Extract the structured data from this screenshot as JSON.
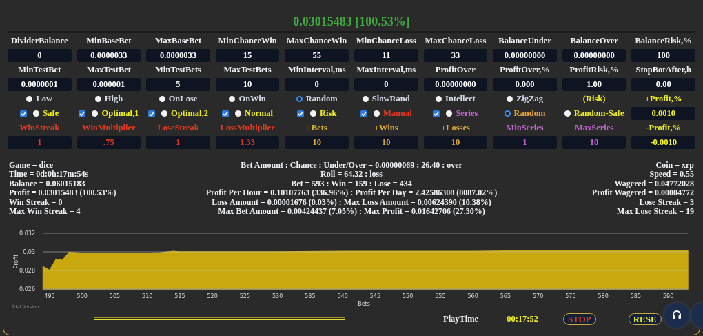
{
  "title": "0.03015483 [100.53%]",
  "settings": {
    "rows": [
      {
        "cells": [
          {
            "kind": "label",
            "text": "DividerBalance"
          },
          {
            "kind": "label",
            "text": "MinBaseBet"
          },
          {
            "kind": "label",
            "text": "MaxBaseBet"
          },
          {
            "kind": "label",
            "text": "MinChanceWin"
          },
          {
            "kind": "label",
            "text": "MaxChanceWin"
          },
          {
            "kind": "label",
            "text": "MinChanceLoss"
          },
          {
            "kind": "label",
            "text": "MaxChanceLoss"
          },
          {
            "kind": "label",
            "text": "BalanceUnder"
          },
          {
            "kind": "label",
            "text": "BalanceOver"
          },
          {
            "kind": "label",
            "text": "BalanceRisk,%"
          }
        ]
      },
      {
        "cells": [
          {
            "kind": "input",
            "value": "0"
          },
          {
            "kind": "input",
            "value": "0.0000033"
          },
          {
            "kind": "input",
            "value": "0.0000033"
          },
          {
            "kind": "input",
            "value": "15"
          },
          {
            "kind": "input",
            "value": "55"
          },
          {
            "kind": "input",
            "value": "11"
          },
          {
            "kind": "input",
            "value": "33"
          },
          {
            "kind": "input",
            "value": "0.00000000"
          },
          {
            "kind": "input",
            "value": "0.00000000"
          },
          {
            "kind": "input",
            "value": "100"
          }
        ]
      },
      {
        "cells": [
          {
            "kind": "label",
            "text": "MinTestBet"
          },
          {
            "kind": "label",
            "text": "MaxTestBet"
          },
          {
            "kind": "label",
            "text": "MinTestBets"
          },
          {
            "kind": "label",
            "text": "MaxTestBets"
          },
          {
            "kind": "label",
            "text": "MinInterval,ms"
          },
          {
            "kind": "label",
            "text": "MaxInterval,ms"
          },
          {
            "kind": "label",
            "text": "ProfitOver"
          },
          {
            "kind": "label",
            "text": "ProfitOver,%"
          },
          {
            "kind": "label",
            "text": "ProfitRisk,%"
          },
          {
            "kind": "label",
            "text": "StopBotAfter,h"
          }
        ]
      },
      {
        "cells": [
          {
            "kind": "input",
            "value": "0.0000001"
          },
          {
            "kind": "input",
            "value": "0.000001"
          },
          {
            "kind": "input",
            "value": "5"
          },
          {
            "kind": "input",
            "value": "10"
          },
          {
            "kind": "input",
            "value": "0"
          },
          {
            "kind": "input",
            "value": "0"
          },
          {
            "kind": "input",
            "value": "0.00000000"
          },
          {
            "kind": "input",
            "value": "0.000"
          },
          {
            "kind": "input",
            "value": "1.00"
          },
          {
            "kind": "input",
            "value": "0.00"
          }
        ]
      },
      {
        "cells": [
          {
            "kind": "radio",
            "label": "Low",
            "selected": false
          },
          {
            "kind": "radio",
            "label": "High",
            "selected": false
          },
          {
            "kind": "radio",
            "label": "OnLose",
            "selected": false
          },
          {
            "kind": "radio",
            "label": "OnWin",
            "selected": false
          },
          {
            "kind": "radio",
            "label": "Random",
            "selected": true
          },
          {
            "kind": "radio",
            "label": "SlowRand",
            "selected": false
          },
          {
            "kind": "radio",
            "label": "Intellect",
            "selected": false
          },
          {
            "kind": "radio",
            "label": "ZigZag",
            "selected": false
          },
          {
            "kind": "label",
            "text": "(Risk)",
            "color": "#f0f020"
          },
          {
            "kind": "label",
            "text": "+Profit,%",
            "color": "#f0f020"
          }
        ]
      },
      {
        "cells": [
          {
            "kind": "check-radio",
            "label": "Safe",
            "checked": true,
            "selected": false,
            "color": "#f0f020"
          },
          {
            "kind": "check-radio",
            "label": "Optimal,1",
            "checked": true,
            "selected": false,
            "color": "#f0f020"
          },
          {
            "kind": "check-radio",
            "label": "Optimal,2",
            "checked": true,
            "selected": false,
            "color": "#f0f020"
          },
          {
            "kind": "check-radio",
            "label": "Normal",
            "checked": true,
            "selected": false,
            "color": "#f0f020"
          },
          {
            "kind": "check-radio",
            "label": "Risk",
            "checked": true,
            "selected": false,
            "color": "#f0f020"
          },
          {
            "kind": "check-radio",
            "label": "Manual",
            "checked": true,
            "selected": false,
            "color": "#e03a22"
          },
          {
            "kind": "check-radio",
            "label": "Series",
            "checked": true,
            "selected": false,
            "color": "#c264d2"
          },
          {
            "kind": "radio",
            "label": "Random",
            "selected": true,
            "color": "#e0a23a"
          },
          {
            "kind": "radio",
            "label": "Random-Safe",
            "selected": false,
            "color": "#f0f020"
          },
          {
            "kind": "input",
            "value": "0.0010",
            "color": "#f0f020"
          }
        ]
      },
      {
        "cells": [
          {
            "kind": "label",
            "text": "WinStreak",
            "color": "#e03a22"
          },
          {
            "kind": "label",
            "text": "WinMultiplier",
            "color": "#e03a22"
          },
          {
            "kind": "label",
            "text": "LoseStreak",
            "color": "#e03a22"
          },
          {
            "kind": "label",
            "text": "LossMultiplier",
            "color": "#e03a22"
          },
          {
            "kind": "label",
            "text": "+Bets",
            "color": "#d8a83a"
          },
          {
            "kind": "label",
            "text": "+Wins",
            "color": "#d8a83a"
          },
          {
            "kind": "label",
            "text": "+Losses",
            "color": "#d8a83a"
          },
          {
            "kind": "label",
            "text": "MinSeries",
            "color": "#c264d2"
          },
          {
            "kind": "label",
            "text": "MaxSeries",
            "color": "#c264d2"
          },
          {
            "kind": "label",
            "text": "-Profit,%",
            "color": "#f0f020"
          }
        ]
      },
      {
        "cells": [
          {
            "kind": "input",
            "value": "1",
            "color": "#e03a22"
          },
          {
            "kind": "input",
            "value": ".75",
            "color": "#e03a22"
          },
          {
            "kind": "input",
            "value": "1",
            "color": "#e03a22"
          },
          {
            "kind": "input",
            "value": "1.33",
            "color": "#e03a22"
          },
          {
            "kind": "input",
            "value": "10",
            "color": "#d8a83a"
          },
          {
            "kind": "input",
            "value": "10",
            "color": "#d8a83a"
          },
          {
            "kind": "input",
            "value": "10",
            "color": "#d8a83a"
          },
          {
            "kind": "input",
            "value": "1",
            "color": "#c264d2"
          },
          {
            "kind": "input",
            "value": "10",
            "color": "#c264d2"
          },
          {
            "kind": "input",
            "value": "-0.0010",
            "color": "#f0f020"
          }
        ]
      }
    ]
  },
  "stats": {
    "left": [
      "Game = dice",
      "Time = 0d:0h:17m:54s",
      "Balance = 0.06015183",
      "Profit = 0.03015483 (100.53%)",
      "Win Streak = 0",
      "Max Win Streak = 4"
    ],
    "center": [
      "Bet Amount : Chance : Under/Over = 0.00000069 : 26.40 : over",
      "Roll = 64.32 : loss",
      "Bet = 593 : Win = 159 : Lose = 434",
      "Profit Per Hour = 0.10107763 (336.96%) : Profit Per Day = 2.42586308 (8087.02%)",
      "Loss Amount = 0.00001676 (0.03%) : Max Loss Amount = 0.00624390 (10.38%)",
      "Max Bet Amount = 0.00424437 (7.05%) : Max Profit = 0.01642706 (27.30%)"
    ],
    "right": [
      "Coin = xrp",
      "Speed = 0.55",
      "Wagered = 0.04772028",
      "Profit Wagered = 0.00004772",
      "Lose Streak = 3",
      "Max Lose Streak = 19"
    ]
  },
  "chart": {
    "note": "Trial Version",
    "chart_data": {
      "type": "area",
      "xlabel": "Bets",
      "ylabel": "Profit",
      "x": [
        494,
        495,
        496,
        497,
        498,
        499,
        500,
        505,
        510,
        512,
        514,
        515,
        520,
        530,
        540,
        550,
        560,
        565,
        570,
        580,
        589,
        590,
        593
      ],
      "series": [
        {
          "color": "#c8a80c",
          "values": [
            0.0284,
            0.028,
            0.0292,
            0.0291,
            0.02995,
            0.0299,
            0.02985,
            0.02985,
            0.02985,
            0.0299,
            0.03005,
            0.03,
            0.03,
            0.03,
            0.03005,
            0.03005,
            0.03005,
            0.0301,
            0.0301,
            0.0301,
            0.0301,
            0.03015,
            0.03015
          ]
        }
      ],
      "xlim": [
        494,
        593
      ],
      "ylim": [
        0.026,
        0.032
      ],
      "xticks": [
        495,
        500,
        505,
        510,
        515,
        520,
        525,
        530,
        535,
        540,
        545,
        550,
        555,
        560,
        565,
        570,
        575,
        580,
        585,
        590
      ],
      "yticks": [
        0.026,
        0.028,
        {
          "value": 0.03,
          "label": "0.03"
        },
        0.032
      ]
    }
  },
  "play_time": {
    "label": "PlayTime",
    "value": "00:17:52"
  },
  "buttons": [
    {
      "kind": "stop",
      "label": "STOP"
    },
    {
      "kind": "reset",
      "label": "RESE"
    }
  ]
}
